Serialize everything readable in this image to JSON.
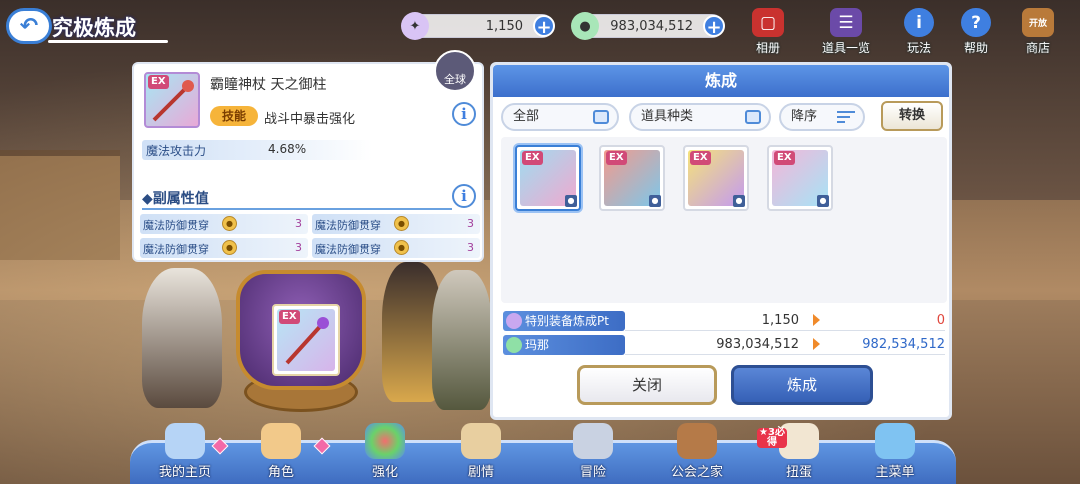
{
  "header": {
    "title": "究极炼成",
    "resources": [
      {
        "name": "pt",
        "value": "1,150",
        "icon": "crystal-icon"
      },
      {
        "name": "mana",
        "value": "983,034,512",
        "icon": "mana-coin-icon"
      }
    ],
    "nav": [
      {
        "label": "相册",
        "icon": "album-icon"
      },
      {
        "label": "道具一览",
        "icon": "item-list-icon"
      },
      {
        "label": "玩法",
        "icon": "info-icon"
      },
      {
        "label": "帮助",
        "icon": "help-icon"
      },
      {
        "label": "商店",
        "icon": "shop-icon",
        "badge": "开放"
      }
    ]
  },
  "equipment": {
    "ex_tag": "EX",
    "name": "霸瞳神杖 天之御柱",
    "skill_badge": "技能",
    "skill_text": "战斗中暴击强化",
    "stat_label": "魔法攻击力",
    "stat_value": "4.68%",
    "sub_title": "◆副属性值",
    "sub_stats": [
      {
        "label": "魔法防御贯穿",
        "value": "3"
      },
      {
        "label": "魔法防御贯穿",
        "value": "3"
      },
      {
        "label": "魔法防御贯穿",
        "value": "3"
      },
      {
        "label": "魔法防御贯穿",
        "value": "3"
      }
    ],
    "unequip_label": "全球",
    "info_glyph": "i"
  },
  "pot_item_tag": "EX",
  "craft_panel": {
    "title": "炼成",
    "filter_all": "全部",
    "filter_type": "道具种类",
    "sort": "降序",
    "convert_button": "转换",
    "items": [
      {
        "tag": "EX",
        "colors": [
          "#9fdcf0",
          "#f0a9cf"
        ],
        "selected": true
      },
      {
        "tag": "EX",
        "colors": [
          "#f39a8c",
          "#7dc7ea"
        ],
        "selected": false
      },
      {
        "tag": "EX",
        "colors": [
          "#f5e27a",
          "#c39af0"
        ],
        "selected": false
      },
      {
        "tag": "EX",
        "colors": [
          "#f4b6d8",
          "#a6e3f6"
        ],
        "selected": false
      }
    ],
    "pt_row": {
      "label": "特别装备炼成Pt",
      "current": "1,150",
      "after": "0",
      "after_color": "#e0463c"
    },
    "mana_row": {
      "label": "玛那",
      "current": "983,034,512",
      "after": "982,534,512",
      "after_color": "#2f68c8"
    },
    "close_button": "关闭",
    "craft_button": "炼成"
  },
  "bottom_nav": [
    {
      "label": "我的主页",
      "icon": "castle-icon"
    },
    {
      "label": "角色",
      "icon": "character-icon"
    },
    {
      "label": "强化",
      "icon": "orbs-icon"
    },
    {
      "label": "剧情",
      "icon": "scroll-icon"
    },
    {
      "label": "冒险",
      "icon": "sword-icon"
    },
    {
      "label": "公会之家",
      "icon": "guild-house-icon"
    },
    {
      "label": "扭蛋",
      "icon": "gacha-icon",
      "badge": "★3必得"
    },
    {
      "label": "主菜单",
      "icon": "crystal-menu-icon"
    }
  ]
}
